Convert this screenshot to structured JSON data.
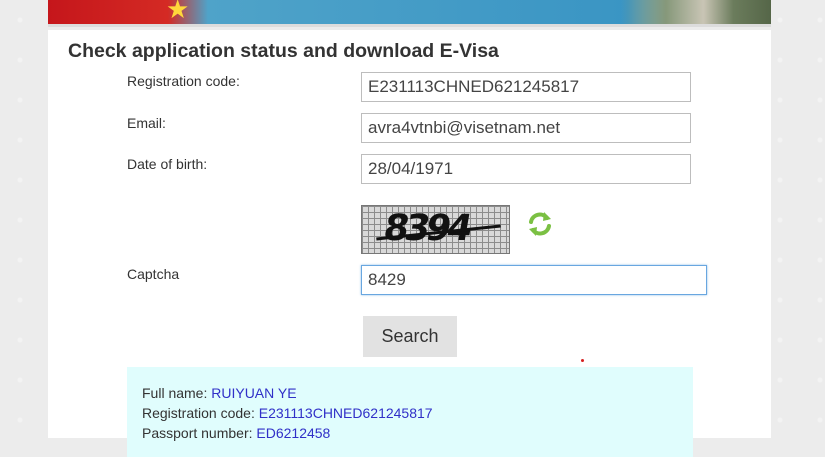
{
  "page": {
    "title": "Check application status and download E-Visa"
  },
  "form": {
    "registration_code": {
      "label": "Registration code:",
      "value": "E231113CHNED621245817"
    },
    "email": {
      "label": "Email:",
      "value": "avra4vtnbi@visetnam.net"
    },
    "date_of_birth": {
      "label": "Date of birth:",
      "value": "28/04/1971"
    },
    "captcha": {
      "label": "Captcha",
      "value": "8429",
      "image_text": "8394"
    },
    "search_label": "Search"
  },
  "result": {
    "full_name_label": "Full name:",
    "full_name": "RUIYUAN YE",
    "registration_code_label": "Registration code:",
    "registration_code": "E231113CHNED621245817",
    "passport_label": "Passport number:",
    "passport_number": "ED6212458"
  },
  "colors": {
    "link_value": "#3030c8",
    "result_bg": "#e0fdfd",
    "focus_border": "#69a7e0",
    "refresh_icon": "#7bc043"
  }
}
